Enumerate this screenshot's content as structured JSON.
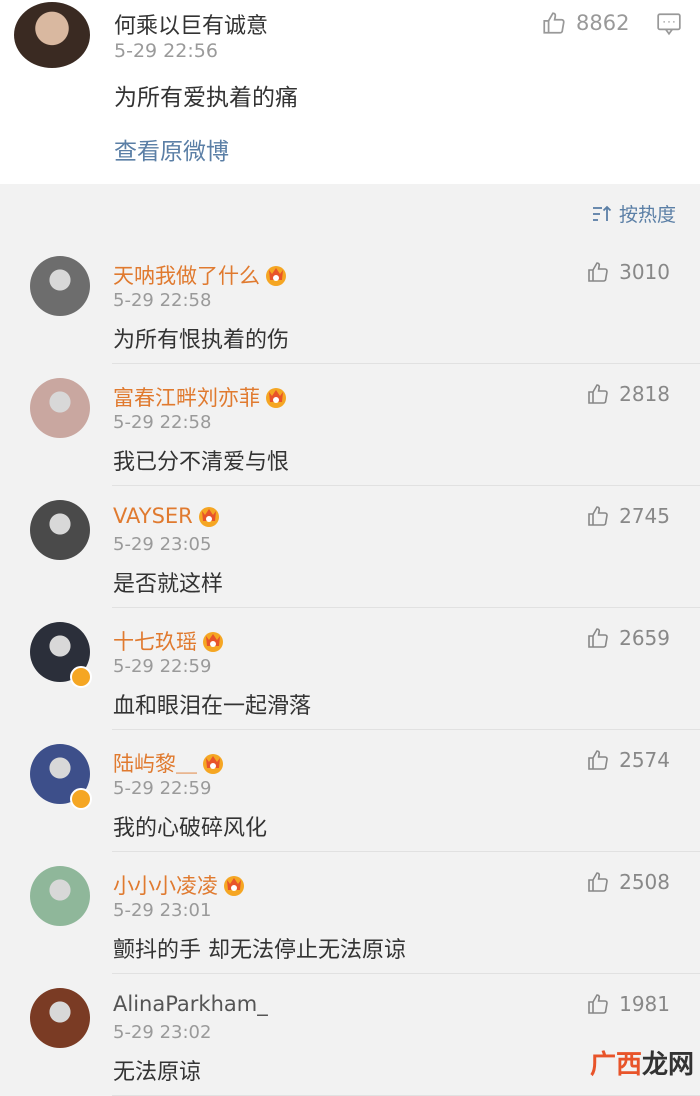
{
  "top_post": {
    "name": "何乘以巨有诚意",
    "time": "5-29 22:56",
    "text": "为所有爱执着的痛",
    "view_original": "查看原微博",
    "likes": "8862"
  },
  "sort_label": "按热度",
  "comments": [
    {
      "name": "天呐我做了什么",
      "time": "5-29 22:58",
      "text": "为所有恨执着的伤",
      "likes": "3010",
      "vip": true,
      "verified": false,
      "avatar_color": "#6d6d6d"
    },
    {
      "name": "富春江畔刘亦菲",
      "time": "5-29 22:58",
      "text": "我已分不清爱与恨",
      "likes": "2818",
      "vip": true,
      "verified": false,
      "avatar_color": "#c9a7a0"
    },
    {
      "name": "VAYSER",
      "time": "5-29 23:05",
      "text": "是否就这样",
      "likes": "2745",
      "vip": true,
      "verified": false,
      "avatar_color": "#4a4a4a"
    },
    {
      "name": "十七玖瑶",
      "time": "5-29 22:59",
      "text": "血和眼泪在一起滑落",
      "likes": "2659",
      "vip": true,
      "verified": true,
      "avatar_color": "#2b2f3a"
    },
    {
      "name": "陆屿黎＿",
      "time": "5-29 22:59",
      "text": "我的心破碎风化",
      "likes": "2574",
      "vip": true,
      "verified": true,
      "avatar_color": "#3d4f8a"
    },
    {
      "name": "小小小凌凌",
      "time": "5-29 23:01",
      "text": "颤抖的手 却无法停止无法原谅",
      "likes": "2508",
      "vip": true,
      "verified": false,
      "avatar_color": "#8fb79a"
    },
    {
      "name": "AlinaParkham_",
      "time": "5-29 23:02",
      "text": "无法原谅",
      "likes": "1981",
      "vip": false,
      "verified": false,
      "avatar_color": "#7a3b24"
    }
  ],
  "watermark": {
    "a": "广西",
    "b": "龙网"
  }
}
